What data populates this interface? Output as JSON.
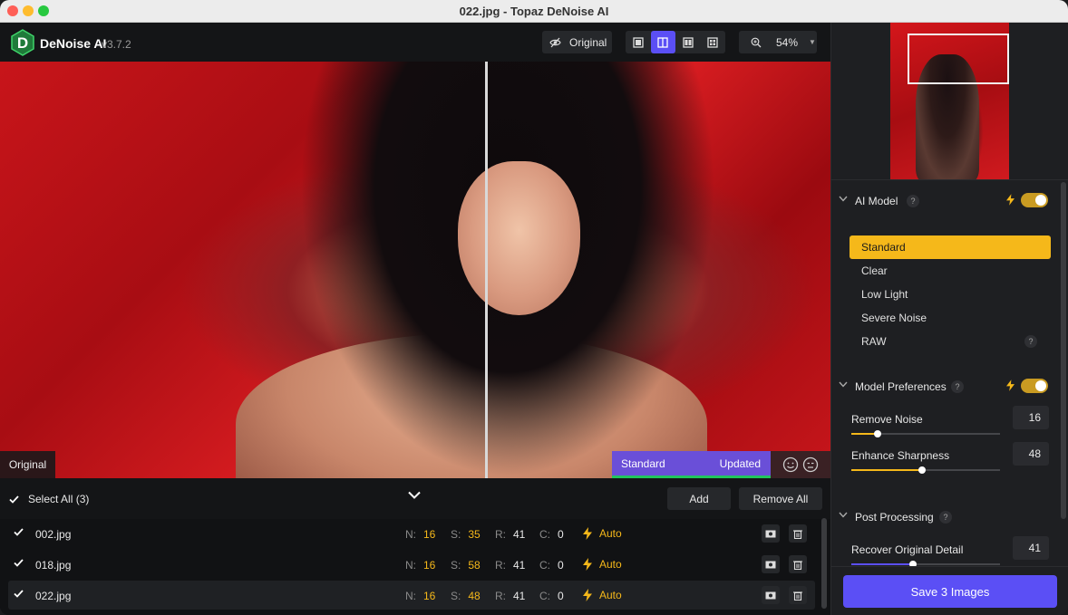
{
  "window": {
    "title": "022.jpg - Topaz DeNoise AI"
  },
  "app": {
    "name": "DeNoise AI",
    "version": "v3.7.2"
  },
  "toolbar": {
    "original_label": "Original",
    "zoom": "54%",
    "icons": [
      "eye-off-icon",
      "single-view-icon",
      "split-view-icon",
      "side-by-side-icon",
      "grid-view-icon",
      "zoom-icon"
    ]
  },
  "preview": {
    "left_label": "Original",
    "model_label": "Standard",
    "status_label": "Updated",
    "accent": "#6a4fd8"
  },
  "files": {
    "select_all": "Select All (3)",
    "add_label": "Add",
    "remove_all_label": "Remove All",
    "rows": [
      {
        "name": "002.jpg",
        "n_label": "N:",
        "n": "16",
        "s_label": "S:",
        "s": "35",
        "r_label": "R:",
        "r": "41",
        "c_label": "C:",
        "c": "0",
        "auto": "Auto"
      },
      {
        "name": "018.jpg",
        "n_label": "N:",
        "n": "16",
        "s_label": "S:",
        "s": "58",
        "r_label": "R:",
        "r": "41",
        "c_label": "C:",
        "c": "0",
        "auto": "Auto"
      },
      {
        "name": "022.jpg",
        "n_label": "N:",
        "n": "16",
        "s_label": "S:",
        "s": "48",
        "r_label": "R:",
        "r": "41",
        "c_label": "C:",
        "c": "0",
        "auto": "Auto"
      }
    ]
  },
  "sidebar": {
    "ai_model": {
      "title": "AI Model",
      "help": "?",
      "models": [
        "Standard",
        "Clear",
        "Low Light",
        "Severe Noise",
        "RAW"
      ],
      "raw_help": "?"
    },
    "preferences": {
      "title": "Model Preferences",
      "help": "?",
      "remove_noise_label": "Remove Noise",
      "remove_noise": "16",
      "enhance_sharpness_label": "Enhance Sharpness",
      "enhance_sharpness": "48"
    },
    "post": {
      "title": "Post Processing",
      "help": "?",
      "recover_label": "Recover Original Detail",
      "recover": "41"
    },
    "save_label": "Save 3 Images"
  },
  "colors": {
    "accent": "#5b4ff5",
    "highlight": "#f5b81a",
    "toggle": "#c99b22"
  }
}
